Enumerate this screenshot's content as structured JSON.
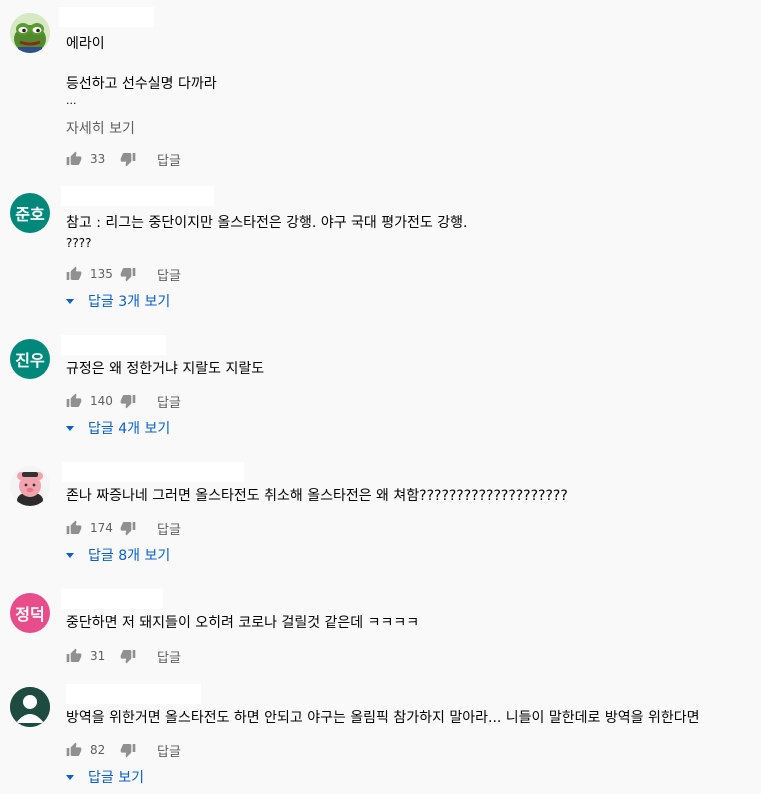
{
  "ui": {
    "dislike_icon": "thumbs-down-icon",
    "like_icon": "thumbs-up-icon",
    "accent_color": "#065fd4"
  },
  "comments": [
    {
      "avatar_text": "",
      "avatar_kind": "frog",
      "lines": [
        "에라이",
        "",
        "등선하고 선수실명 다까라",
        "..."
      ],
      "more_label": "자세히 보기",
      "likes": "33",
      "reply_label": "답글",
      "replies_label": ""
    },
    {
      "avatar_text": "준호",
      "avatar_color": "#00897b",
      "lines": [
        "참고 : 리그는 중단이지만 올스타전은 강행. 야구 국대 평가전도 강행.",
        "????"
      ],
      "likes": "135",
      "reply_label": "답글",
      "replies_label": "답글 3개 보기"
    },
    {
      "avatar_text": "진우",
      "avatar_color": "#00897b",
      "lines": [
        "규정은 왜 정한거냐 지랄도 지랄도"
      ],
      "likes": "140",
      "reply_label": "답글",
      "replies_label": "답글 4개 보기"
    },
    {
      "avatar_text": "",
      "avatar_kind": "character",
      "lines": [
        "존나 짜증나네 그러면 올스타전도 취소해 올스타전은 왜 쳐함????????????????????"
      ],
      "likes": "174",
      "reply_label": "답글",
      "replies_label": "답글 8개 보기"
    },
    {
      "avatar_text": "정덕",
      "avatar_color": "#e84c8a",
      "lines": [
        "중단하면 저 돼지들이 오히려 코로나 걸릴것 같은데 ㅋㅋㅋㅋ"
      ],
      "likes": "31",
      "reply_label": "답글",
      "replies_label": ""
    },
    {
      "avatar_text": "",
      "avatar_kind": "default",
      "lines": [
        "방역을 위한거면 올스타전도 하면 안되고 야구는 올림픽 참가하지 말아라... 니들이 말한데로 방역을 위한다면"
      ],
      "likes": "82",
      "reply_label": "답글",
      "replies_label": "답글 보기"
    }
  ]
}
